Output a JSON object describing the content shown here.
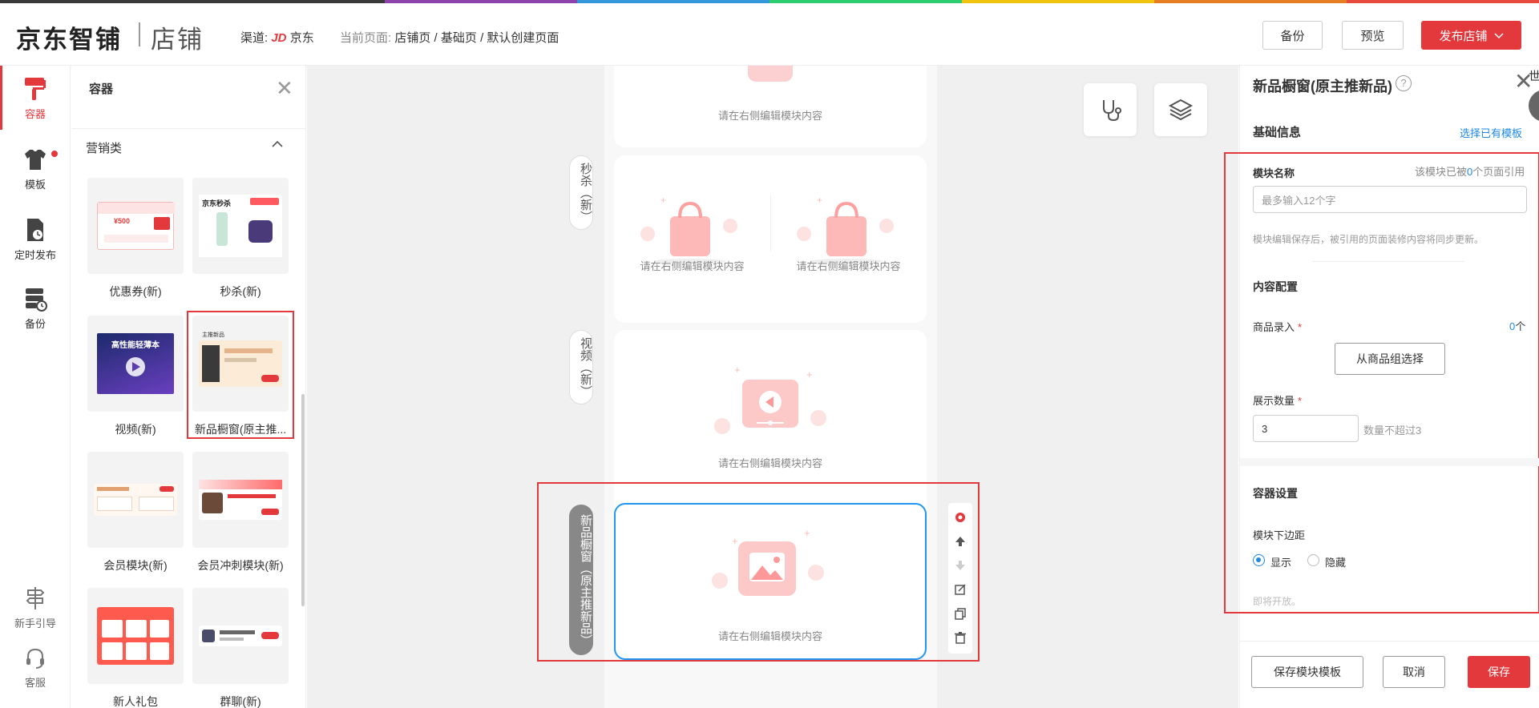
{
  "colors": {
    "brand_red": "#e4393c",
    "link_blue": "#1e88e5",
    "top_stripe": [
      "#3a3a3a",
      "#8e44ad",
      "#3498db",
      "#2ecc71",
      "#f1c40f",
      "#e67e22",
      "#e74c3c"
    ]
  },
  "header": {
    "logo": "京东智铺",
    "logo_sub": "店铺",
    "channel_label": "渠道:",
    "channel_jd": "JD",
    "channel_name": "京东",
    "current_page_label": "当前页面:",
    "breadcrumb": [
      "店铺页",
      "基础页",
      "默认创建页面"
    ],
    "crumb_sep": "/",
    "backup_button": "备份",
    "preview_button": "预览",
    "publish_button": "发布店铺"
  },
  "rail": {
    "items": [
      {
        "label": "容器",
        "icon": "paint-roller-icon",
        "active": true
      },
      {
        "label": "模板",
        "icon": "tshirt-icon"
      },
      {
        "label": "定时发布",
        "icon": "scheduled-doc-icon"
      },
      {
        "label": "备份",
        "icon": "database-clock-icon"
      }
    ],
    "bottom": [
      {
        "label": "新手引导",
        "icon": "signpost-icon"
      },
      {
        "label": "客服",
        "icon": "headset-icon"
      }
    ]
  },
  "panel": {
    "title": "容器",
    "category": "营销类",
    "cards": [
      {
        "label": "优惠券(新)"
      },
      {
        "label": "秒杀(新)"
      },
      {
        "label": "视频(新)"
      },
      {
        "label": "新品橱窗(原主推..."
      },
      {
        "label": "会员模块(新)"
      },
      {
        "label": "会员冲刺模块(新)"
      },
      {
        "label": "新人礼包"
      },
      {
        "label": "群聊(新)"
      }
    ],
    "thumb_texts": {
      "seckill": "京东秒杀",
      "video": "高性能轻薄本",
      "coupon_price": "¥500",
      "window_tag": "主推新品"
    }
  },
  "canvas": {
    "placeholder": "请在右侧编辑模块内容",
    "tags": {
      "seckill": "秒杀（新）",
      "video": "视频（新）",
      "window": "新品橱窗（原主推新品）"
    },
    "tools": [
      "stethoscope-icon",
      "layers-icon"
    ],
    "module_tools": [
      "gear-icon",
      "arrow-up-icon",
      "arrow-down-icon",
      "edit-icon",
      "copy-icon",
      "trash-icon"
    ]
  },
  "right_panel": {
    "title": "新品橱窗(原主推新品)",
    "help": "?",
    "basic_info": "基础信息",
    "choose_template": "选择已有模板",
    "module_name_label": "模块名称",
    "ref_prefix": "该模块已被",
    "ref_count": "0",
    "ref_suffix": "个页面引用",
    "name_placeholder": "最多输入12个字",
    "sync_hint": "模块编辑保存后，被引用的页面装修内容将同步更新。",
    "content_config": "内容配置",
    "product_entry_label": "商品录入",
    "product_count": "0",
    "product_count_unit": "个",
    "select_from_group": "从商品组选择",
    "display_count_label": "展示数量",
    "display_count_value": "3",
    "display_count_hint": "数量不超过3",
    "container_settings": "容器设置",
    "bottom_margin_label": "模块下边距",
    "show_option": "显示",
    "hide_option": "隐藏",
    "coming_soon": "即将开放。",
    "save_template": "保存模块模板",
    "cancel": "取消",
    "save": "保存",
    "edge_char": "世",
    "required_mark": "*"
  }
}
